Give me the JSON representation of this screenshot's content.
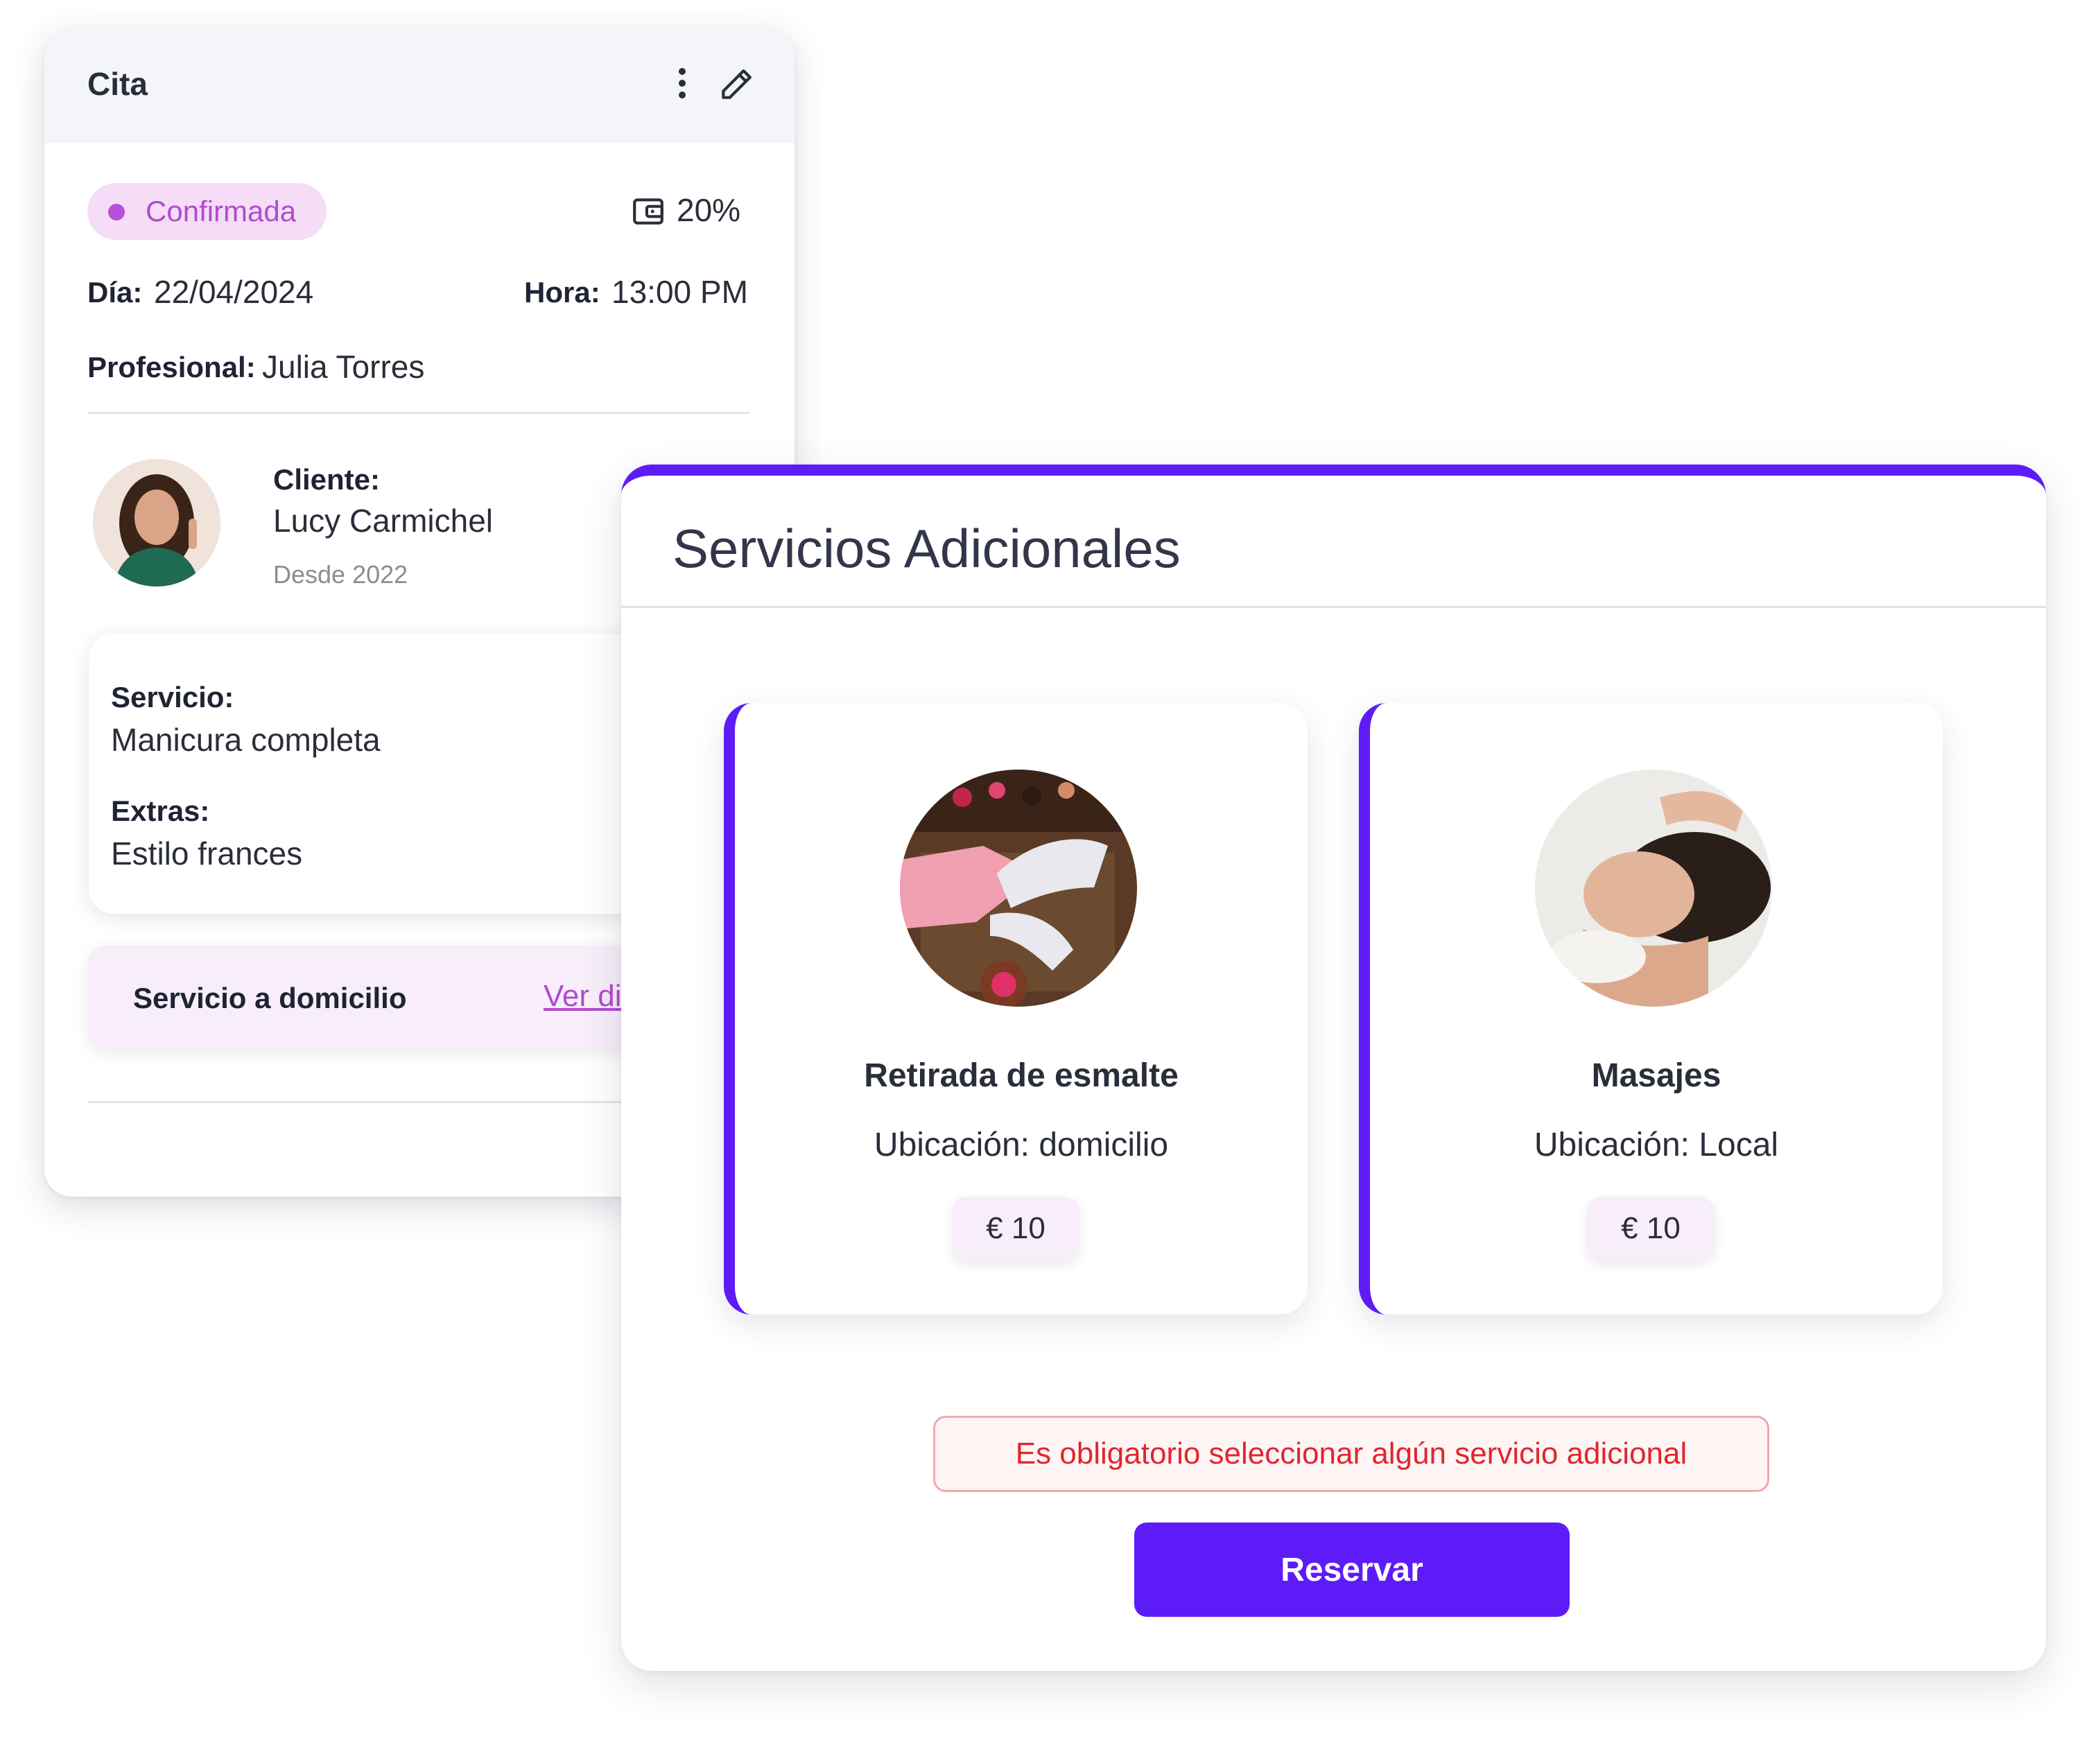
{
  "colors": {
    "accent": "#5d1cf7",
    "status_bg": "#f5dcf7",
    "status_text": "#b04bd0",
    "error_text": "#e0262d",
    "error_border": "#f2a7ad",
    "price_bg": "#f7eefa"
  },
  "appointment": {
    "title": "Cita",
    "menu_icon": "more-vertical-icon",
    "edit_icon": "pencil-icon",
    "status": "Confirmada",
    "discount_icon": "wallet-icon",
    "discount": "20%",
    "day_label": "Día:",
    "day_value": "22/04/2024",
    "time_label": "Hora:",
    "time_value": "13:00 PM",
    "professional_label": "Profesional:",
    "professional_value": "Julia Torres",
    "client_label": "Cliente:",
    "client_name": "Lucy Carmichel",
    "client_since": "Desde 2022",
    "service_label": "Servicio:",
    "service_value": "Manicura completa",
    "extras_label": "Extras:",
    "extras_value": "Estilo frances",
    "home_service_label": "Servicio a domicilio",
    "home_service_link": "Ver dirección"
  },
  "additional_services": {
    "title": "Servicios Adicionales",
    "items": [
      {
        "name": "Retirada de esmalte",
        "location": "Ubicación: domicilio",
        "price": "€ 10"
      },
      {
        "name": "Masajes",
        "location": "Ubicación: Local",
        "price": "€ 10"
      }
    ],
    "error": "Es obligatorio seleccionar algún servicio adicional",
    "reserve_button": "Reservar"
  }
}
